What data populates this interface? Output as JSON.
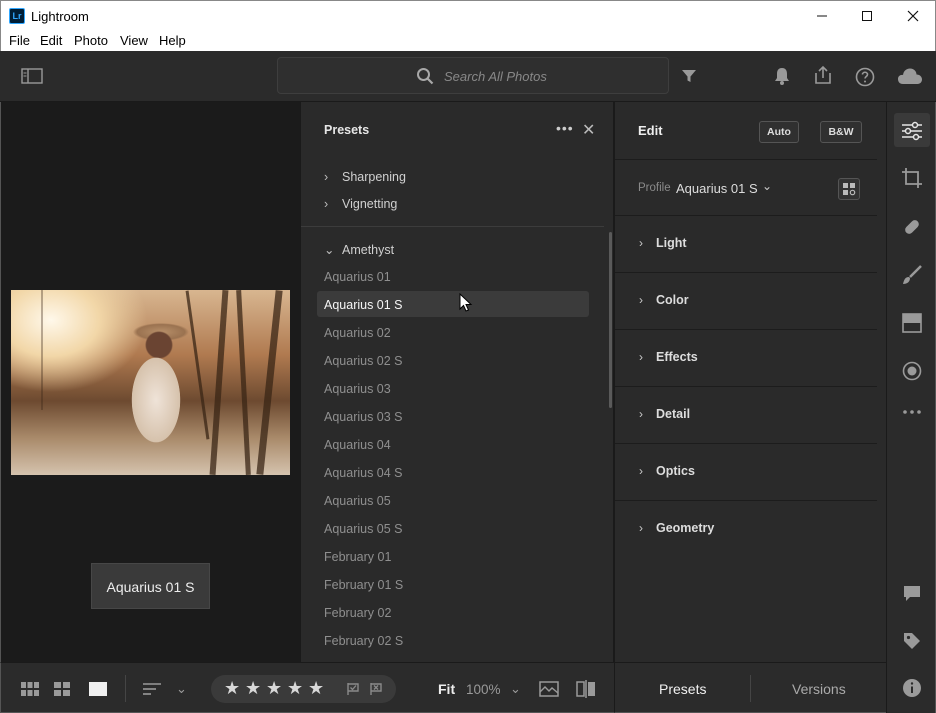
{
  "window": {
    "title": "Lightroom",
    "logo_text": "Lr"
  },
  "menu": [
    "File",
    "Edit",
    "Photo",
    "View",
    "Help"
  ],
  "toolbar": {
    "search_placeholder": "Search All Photos"
  },
  "preview": {
    "label": "Aquarius 01 S"
  },
  "presets": {
    "title": "Presets",
    "more_label": "•••",
    "close_label": "✕",
    "groups_top": [
      {
        "label": "Sharpening"
      },
      {
        "label": "Vignetting"
      }
    ],
    "open_group": "Amethyst",
    "items": [
      "Aquarius 01",
      "Aquarius 01 S",
      "Aquarius 02",
      "Aquarius 02 S",
      "Aquarius 03",
      "Aquarius 03 S",
      "Aquarius 04",
      "Aquarius 04 S",
      "Aquarius 05",
      "Aquarius 05 S",
      "February 01",
      "February 01 S",
      "February 02",
      "February 02 S"
    ],
    "selected": "Aquarius 01 S"
  },
  "edit": {
    "title": "Edit",
    "auto_label": "Auto",
    "bw_label": "B&W",
    "profile_label": "Profile",
    "profile_value": "Aquarius 01 S",
    "sections": [
      "Light",
      "Color",
      "Effects",
      "Detail",
      "Optics",
      "Geometry"
    ]
  },
  "bottom": {
    "fit_label": "Fit",
    "zoom_value": "100%",
    "rating_stars": 5
  },
  "bottom_tabs": {
    "presets": "Presets",
    "versions": "Versions"
  },
  "colors": {
    "accent": "#31a8ff",
    "panel": "#2a2a2a",
    "rail": "#2b2b2b"
  }
}
